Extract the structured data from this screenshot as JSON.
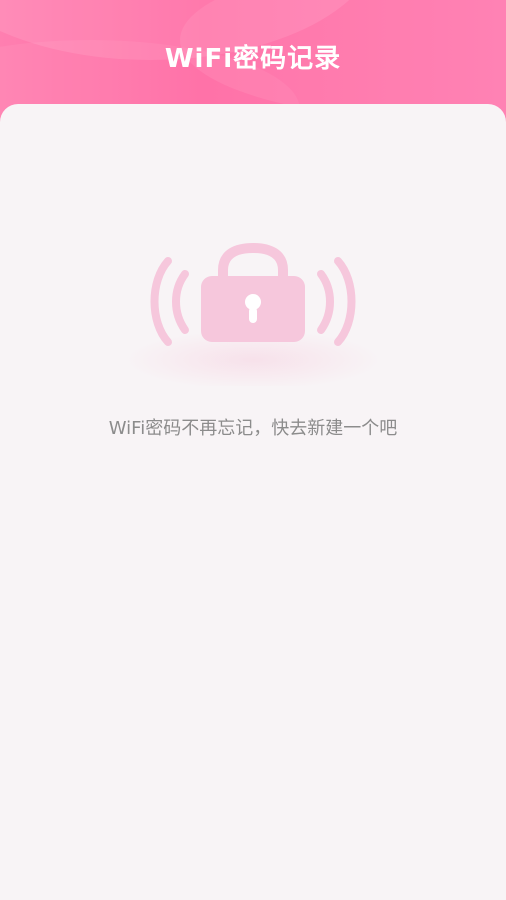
{
  "header": {
    "title": "WiFi密码记录"
  },
  "empty_state": {
    "message": "WiFi密码不再忘记，快去新建一个吧",
    "illustration_icon": "wifi-lock-icon"
  },
  "colors": {
    "header_start": "#ff7fb0",
    "header_end": "#ff6aa3",
    "content_background": "#f8f4f6",
    "illustration_pink": "#f6c7dc",
    "text_gray": "#8c8c8c"
  }
}
